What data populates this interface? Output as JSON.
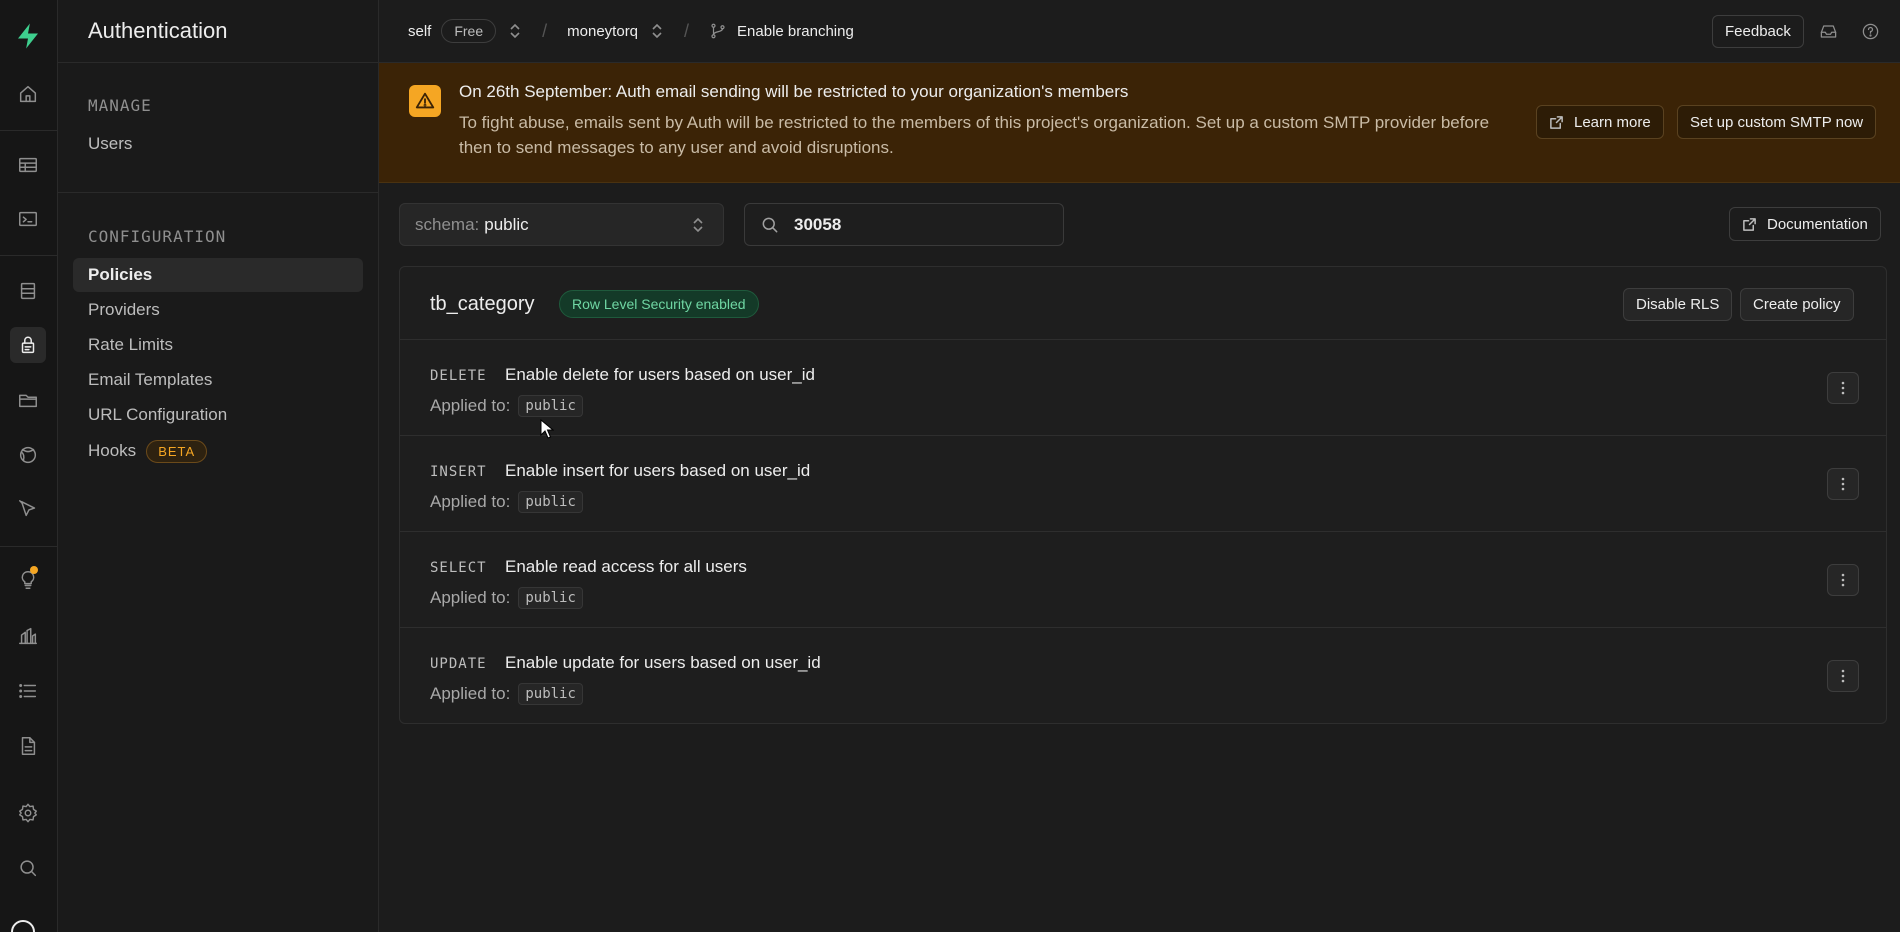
{
  "sidebar": {
    "title": "Authentication",
    "groups": [
      {
        "label": "MANAGE",
        "items": [
          {
            "label": "Users"
          }
        ]
      },
      {
        "label": "CONFIGURATION",
        "items": [
          {
            "label": "Policies",
            "active": true
          },
          {
            "label": "Providers"
          },
          {
            "label": "Rate Limits"
          },
          {
            "label": "Email Templates"
          },
          {
            "label": "URL Configuration"
          },
          {
            "label": "Hooks",
            "badge": "BETA"
          }
        ]
      }
    ]
  },
  "rail": {
    "icons": [
      "logo-icon",
      "home-icon",
      "table-editor-icon",
      "sql-editor-icon",
      "database-icon",
      "auth-icon",
      "storage-icon",
      "realtime-icon",
      "edge-functions-icon",
      "advisors-icon",
      "reports-icon",
      "logs-icon",
      "api-docs-icon",
      "settings-icon",
      "search-icon"
    ],
    "accent": "#3ecf8e",
    "notification_color": "#f5a623"
  },
  "topbar": {
    "org": "self",
    "plan": "Free",
    "project": "moneytorq",
    "branching": "Enable branching",
    "feedback": "Feedback"
  },
  "banner": {
    "title": "On 26th September: Auth email sending will be restricted to your organization's members",
    "body": "To fight abuse, emails sent by Auth will be restricted to the members of this project's organization. Set up a custom SMTP provider before then to send messages to any user and avoid disruptions.",
    "learn_more": "Learn more",
    "setup_smtp": "Set up custom SMTP now",
    "color": "#f5a623"
  },
  "toolbar": {
    "schema_label": "schema:",
    "schema_value": "public",
    "search_value": "30058",
    "documentation": "Documentation"
  },
  "table": {
    "name": "tb_category",
    "rls_badge": "Row Level Security enabled",
    "disable_rls": "Disable RLS",
    "create_policy": "Create policy",
    "applied_label": "Applied to:",
    "policies": [
      {
        "command": "DELETE",
        "name": "Enable delete for users based on user_id",
        "role": "public"
      },
      {
        "command": "INSERT",
        "name": "Enable insert for users based on user_id",
        "role": "public"
      },
      {
        "command": "SELECT",
        "name": "Enable read access for all users",
        "role": "public"
      },
      {
        "command": "UPDATE",
        "name": "Enable update for users based on user_id",
        "role": "public"
      }
    ]
  }
}
